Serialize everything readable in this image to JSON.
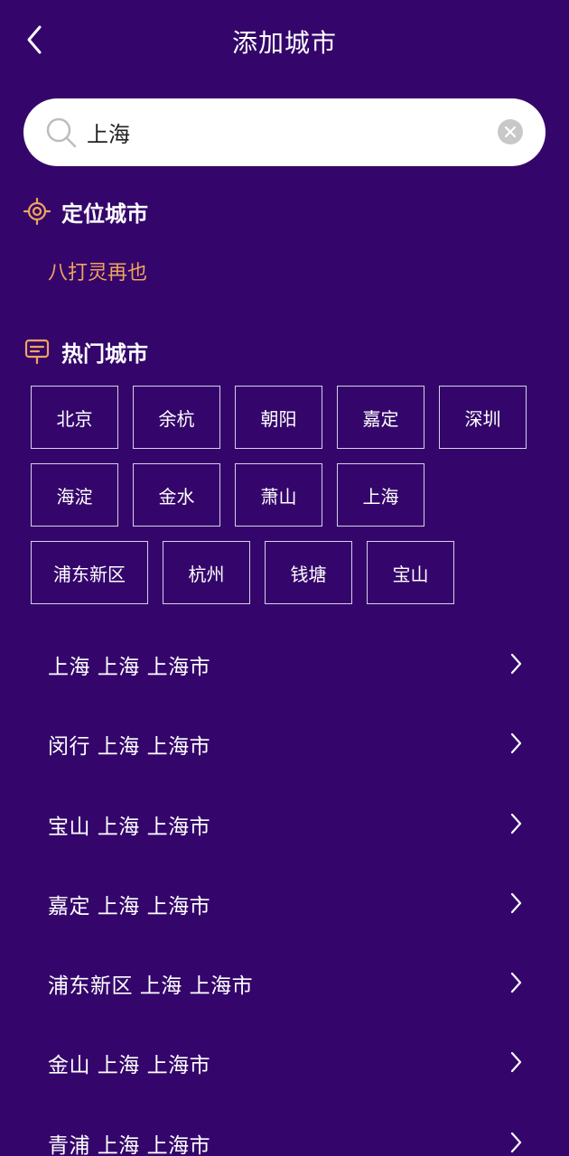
{
  "header": {
    "title": "添加城市",
    "back_icon": "chevron-left-icon"
  },
  "search": {
    "value": "上海",
    "placeholder": "",
    "search_icon": "search-icon",
    "clear_icon": "clear-icon"
  },
  "located": {
    "heading": "定位城市",
    "icon": "target-icon",
    "city": "八打灵再也"
  },
  "hot": {
    "heading": "热门城市",
    "icon": "signboard-icon",
    "rows": [
      [
        "北京",
        "余杭",
        "朝阳",
        "嘉定",
        "深圳"
      ],
      [
        "海淀",
        "金水",
        "萧山",
        "上海"
      ],
      [
        "浦东新区",
        "杭州",
        "钱塘",
        "宝山"
      ]
    ]
  },
  "results": [
    "上海 上海 上海市",
    "闵行 上海 上海市",
    "宝山 上海 上海市",
    "嘉定 上海 上海市",
    "浦东新区 上海 上海市",
    "金山 上海 上海市",
    "青浦 上海 上海市"
  ],
  "colors": {
    "background": "#34066b",
    "accent_orange": "#f0a45c",
    "search_bg": "#ffffff"
  }
}
